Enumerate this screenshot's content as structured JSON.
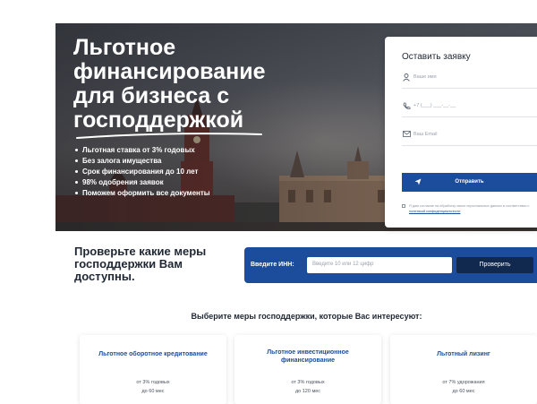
{
  "hero": {
    "title_lines": [
      "Льготное",
      "финансирование",
      "для бизнеса с",
      "господдержкой"
    ],
    "bullets": [
      "Льготная ставка от 3% годовых",
      "Без залога имущества",
      "Срок финансирования до 10 лет",
      "98% одобрения заявок",
      "Поможем оформить все документы"
    ]
  },
  "form": {
    "title": "Оставить заявку",
    "name_placeholder": "Ваше имя",
    "phone_placeholder": "+7 (___) ___-__-__",
    "email_placeholder": "Ваш Email",
    "submit_label": "Отправить",
    "consent_text": "Я даю согласие на обработку своих персональных данных в соответствии с",
    "consent_link": "политикой конфиденциальности",
    "icons": [
      "user-icon",
      "phone-icon",
      "email-icon",
      "paper-plane-icon"
    ]
  },
  "inn": {
    "heading": "Проверьте какие меры господдержки Вам доступны.",
    "label": "Введите ИНН:",
    "placeholder": "Введите 10 или 12 цифр",
    "button_label": "Проверить"
  },
  "measures": {
    "heading": "Выберите меры господдержки, которые Вас интересуют:",
    "cards": [
      {
        "name": "Льготное оборотное кредитование",
        "rate": "от 3% годовых",
        "term": "до 60 мес"
      },
      {
        "name": "Льготное инвестиционное финансирование",
        "rate": "от 3% годовых",
        "term": "до 120 мес"
      },
      {
        "name": "Льготный лизинг",
        "rate": "от 7% удорожания",
        "term": "до 60 мес"
      }
    ]
  },
  "colors": {
    "brand_blue": "#1b4d9c",
    "dark_navy": "#11284f",
    "text_dark": "#1f2733"
  }
}
